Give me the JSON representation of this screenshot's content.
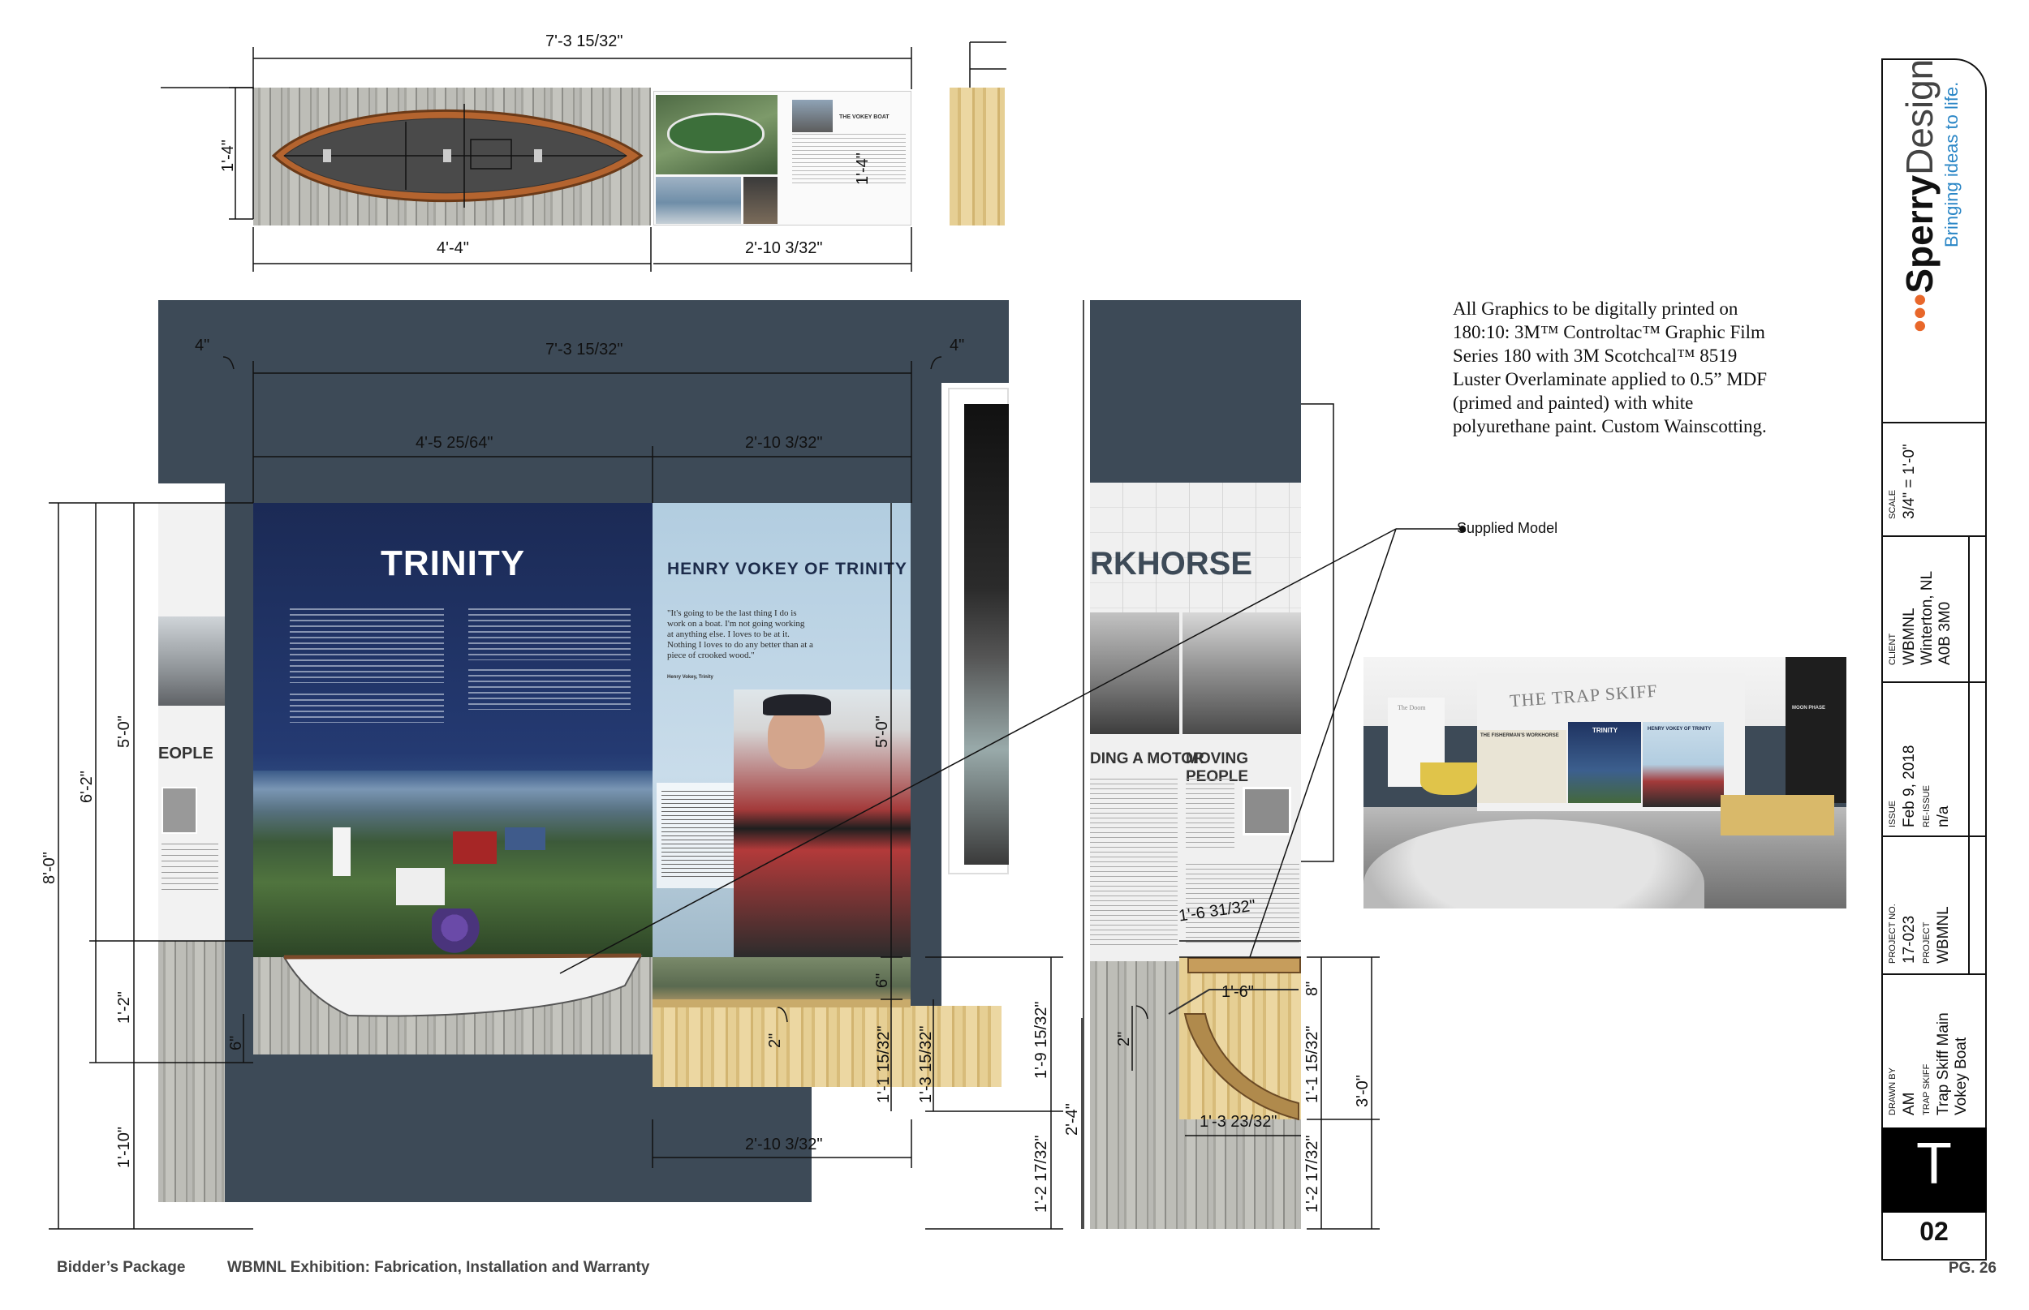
{
  "dimensions": {
    "top_width": "7'-3 15/32\"",
    "top_height": "1'-4\"",
    "top_left_width": "4'-4\"",
    "top_right_width": "2'-10 3/32\"",
    "top_rot": "1'-4\"",
    "main_width": "7'-3 15/32\"",
    "main_corner_left": "4\"",
    "main_corner_right": "4\"",
    "main_left_width": "4'-5 25/64\"",
    "main_right_width": "2'-10 3/32\"",
    "h_total": "8'-0\"",
    "h_panel_total": "6'-2\"",
    "h_panel": "5'-0\"",
    "h_lower": "1'-2\"",
    "h_6": "6\"",
    "h_base": "1'-10\"",
    "case_height": "5'-0\"",
    "case_6": "6\"",
    "case_2": "2\"",
    "case_1_1": "1'-1 15/32\"",
    "case_1_3": "1'-3 15/32\"",
    "case_1_9": "1'-9 15/32\"",
    "case_1_2": "1'-2 17/32\"",
    "case_bottom_width": "2'-10 3/32\"",
    "side_2_4": "2'-4\"",
    "side_2": "2\"",
    "side_1_6_31": "1'-6 31/32\"",
    "side_1_6": "1'-6\"",
    "side_1_3_23": "1'-3 23/32\"",
    "side_8": "8\"",
    "side_1_1": "1'-1 15/32\"",
    "side_3_0": "3'-0\"",
    "side_1_2": "1'-2 17/32\""
  },
  "panels": {
    "trinity_title": "TRINITY",
    "henry_title": "HENRY VOKEY OF TRINITY",
    "henry_quote": "\"It's going to be the last thing I do is work on a boat. I'm not going working at anything else. I loves to be at it. Nothing I loves to do any better than at a piece of crooked wood.\"",
    "henry_attrib": "Henry Vokey, Trinity",
    "workhorse_title": "RKHORSE",
    "motor_title": "DING A MOTOR",
    "moving_title": "MOVING PEOPLE",
    "people_title": "EOPLE",
    "vokey_boat_title": "THE VOKEY BOAT"
  },
  "note": "All Graphics to be digitally printed on 180:10: 3M™ Controltac™ Graphic Film Series 180 with 3M Scotchcal™ 8519 Luster Overlaminate applied to 0.5” MDF (primed and painted) with white polyurethane paint. Custom Wainscotting.",
  "callout": "Supplied Model",
  "render": {
    "sign": "THE TRAP SKIFF",
    "panel_a": "THE FISHERMAN'S WORKHORSE",
    "panel_b": "TRINITY",
    "panel_c": "HENRY VOKEY OF TRINITY",
    "panel_d": "MOON PHASE",
    "panel_e": "The Doom"
  },
  "titleblock": {
    "brand_bold": "Sperry",
    "brand_light": "Design",
    "tagline": "Bringing ideas to life.",
    "scale_label": "SCALE",
    "scale_value": "3/4\" = 1'-0\"",
    "client_label": "CLIENT",
    "client_lines": [
      "WBMNL",
      "Winterton, NL",
      "A0B 3M0"
    ],
    "issue_label": "ISSUE",
    "issue_value": "Feb 9, 2018",
    "reissue_label": "RE-ISSUE",
    "reissue_value": "n/a",
    "project_no_label": "PROJECT NO.",
    "project_no_value": "17-023",
    "project_label": "PROJECT",
    "project_value": "WBMNL",
    "drawn_label": "DRAWN BY",
    "drawn_value": "AM",
    "subject_label": "TRAP SKIFF",
    "subject_lines": [
      "Trap Skiff Main",
      "Vokey Boat"
    ],
    "letter": "T",
    "sheet": "02",
    "page": "PG. 26"
  },
  "footer": {
    "left": "Bidder’s Package",
    "middle": "WBMNL Exhibition: Fabrication, Installation and Warranty"
  },
  "colors": {
    "wall_navy": "#3d4a57",
    "panel_blue": "#1f3361",
    "henry_bg": "#b7cfe0",
    "accent_orange": "#e8672a",
    "tagline_blue": "#2a86c6"
  }
}
